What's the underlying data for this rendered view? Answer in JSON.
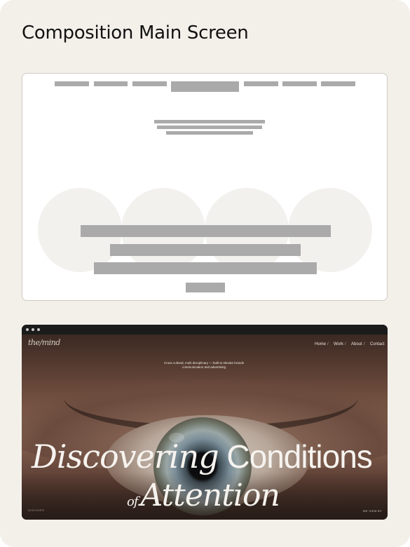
{
  "title": "Composition Main Screen",
  "site": {
    "logo": "the/mind",
    "nav": [
      {
        "label": "Home"
      },
      {
        "label": "Work"
      },
      {
        "label": "About"
      },
      {
        "label": "Contact"
      }
    ],
    "nav_separator": "/",
    "tagline_line1": "Cross cultural, multi disciplinary — built to elevate brands",
    "tagline_line2": "communication and advertising",
    "headline": {
      "word1": "Discovering",
      "word2": "Conditions",
      "word3": "of",
      "word4": "Attention"
    },
    "footer_left": "DISCOVER",
    "footer_right": "WE VIEW BY"
  },
  "colors": {
    "card_background": "#f3f0ea",
    "wireframe_block": "#aaaaaa",
    "wireframe_circle": "#f3f1ee",
    "browser_chrome": "#1b1b1b"
  }
}
